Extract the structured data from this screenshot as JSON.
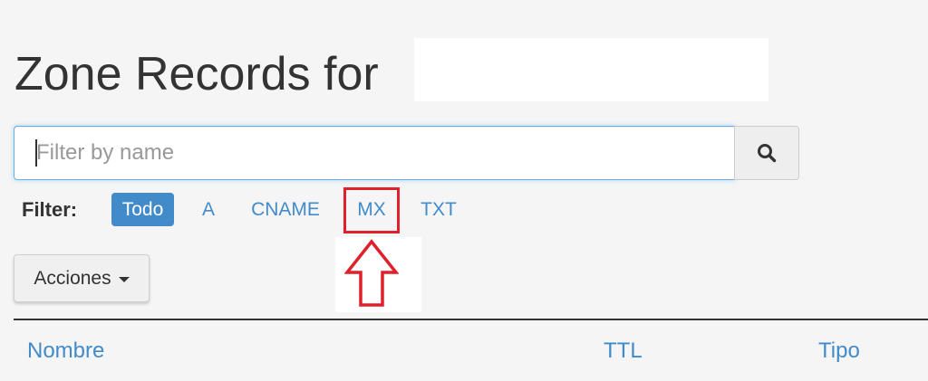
{
  "page": {
    "title": "Zone Records for"
  },
  "search": {
    "placeholder": "Filter by name",
    "button_icon": "search-icon"
  },
  "filter": {
    "label": "Filter:",
    "options": [
      {
        "label": "Todo",
        "active": true
      },
      {
        "label": "A",
        "active": false
      },
      {
        "label": "CNAME",
        "active": false
      },
      {
        "label": "MX",
        "active": false
      },
      {
        "label": "TXT",
        "active": false
      }
    ]
  },
  "actions": {
    "label": "Acciones",
    "icon": "caret-down-icon"
  },
  "table": {
    "columns": [
      "Nombre",
      "TTL",
      "Tipo"
    ]
  },
  "colors": {
    "accent": "#428bca",
    "highlight": "#e0202a",
    "background": "#f5f5f5"
  }
}
